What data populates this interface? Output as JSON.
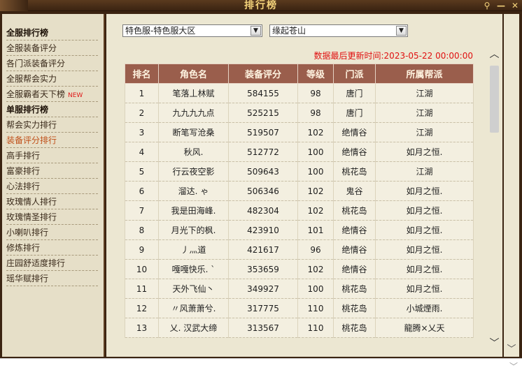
{
  "window": {
    "title": "排行榜",
    "controls": [
      "⚲",
      "—",
      "✕"
    ]
  },
  "sidebar": {
    "items": [
      {
        "label": "全服排行榜",
        "type": "header"
      },
      {
        "label": "全服装备评分",
        "type": "item"
      },
      {
        "label": "各门派装备评分",
        "type": "item"
      },
      {
        "label": "全服帮会实力",
        "type": "item"
      },
      {
        "label": "全服霸者天下榜",
        "type": "item",
        "badge": "NEW"
      },
      {
        "label": "单服排行榜",
        "type": "header"
      },
      {
        "label": "帮会实力排行",
        "type": "item"
      },
      {
        "label": "装备评分排行",
        "type": "item",
        "active": true
      },
      {
        "label": "高手排行",
        "type": "item"
      },
      {
        "label": "富豪排行",
        "type": "item"
      },
      {
        "label": "心法排行",
        "type": "item"
      },
      {
        "label": "玫瑰情人排行",
        "type": "item"
      },
      {
        "label": "玫瑰情圣排行",
        "type": "item"
      },
      {
        "label": "小喇叭排行",
        "type": "item"
      },
      {
        "label": "修炼排行",
        "type": "item"
      },
      {
        "label": "庄园舒适度排行",
        "type": "item"
      },
      {
        "label": "瑶华赋排行",
        "type": "item"
      }
    ]
  },
  "filters": {
    "server": "特色服-特色服大区",
    "realm": "缘起苍山"
  },
  "update": {
    "label": "数据最后更新时间:",
    "time": "2023-05-22 00:00:00"
  },
  "table": {
    "headers": [
      "排名",
      "角色名",
      "装备评分",
      "等级",
      "门派",
      "所属帮派"
    ],
    "rows": [
      [
        "1",
        "笔落丄林赋",
        "584155",
        "98",
        "唐门",
        "江湖"
      ],
      [
        "2",
        "九九九九点",
        "525215",
        "98",
        "唐门",
        "江湖"
      ],
      [
        "3",
        "断笔写沧桑",
        "519507",
        "102",
        "绝情谷",
        "江湖"
      ],
      [
        "4",
        "秋风.",
        "512772",
        "100",
        "绝情谷",
        "如月之恒."
      ],
      [
        "5",
        "行云夜空影",
        "509643",
        "100",
        "桃花岛",
        "江湖"
      ],
      [
        "6",
        "溜达. ゃ",
        "506346",
        "102",
        "鬼谷",
        "如月之恒."
      ],
      [
        "7",
        "我是田海峰.",
        "482304",
        "102",
        "桃花岛",
        "如月之恒."
      ],
      [
        "8",
        "月光下的枫.",
        "423910",
        "101",
        "绝情谷",
        "如月之恒."
      ],
      [
        "9",
        "丿灬道",
        "421617",
        "96",
        "绝情谷",
        "如月之恒."
      ],
      [
        "10",
        "嘎嘎快乐. `",
        "353659",
        "102",
        "绝情谷",
        "如月之恒."
      ],
      [
        "11",
        "天外飞仙丶",
        "349927",
        "100",
        "桃花岛",
        "如月之恒."
      ],
      [
        "12",
        "〃风萧萧兮.",
        "317775",
        "110",
        "桃花岛",
        "小城煙雨."
      ],
      [
        "13",
        "乂. 汉武大缔",
        "313567",
        "110",
        "桃花岛",
        "龍腾×乂天"
      ]
    ]
  }
}
